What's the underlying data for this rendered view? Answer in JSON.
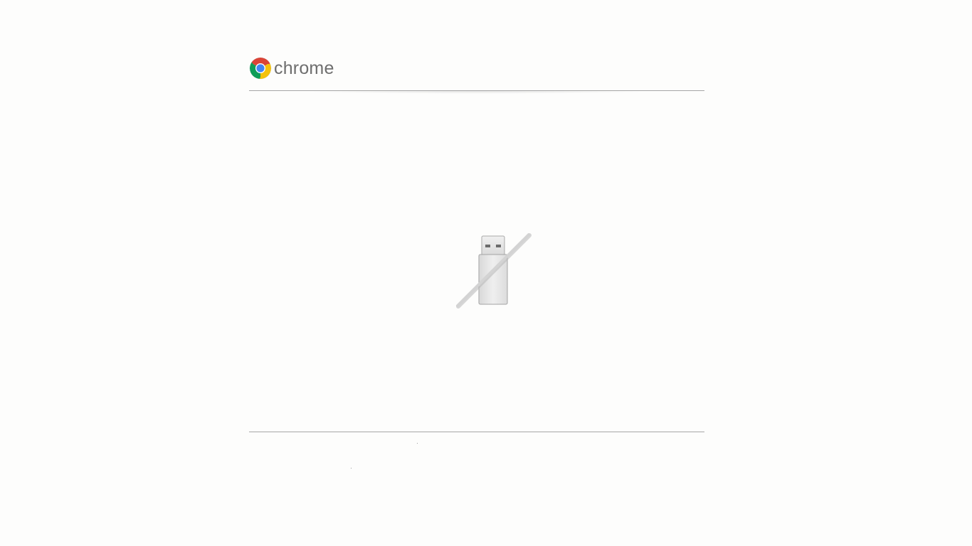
{
  "header": {
    "brand": "chrome",
    "logo_icon": "chrome-logo-icon"
  },
  "main": {
    "status_icon": "usb-drive-disabled-icon"
  },
  "colors": {
    "background": "#fdfdfc",
    "divider": "#a6a6a6",
    "brand_text": "#6e6e6e"
  }
}
